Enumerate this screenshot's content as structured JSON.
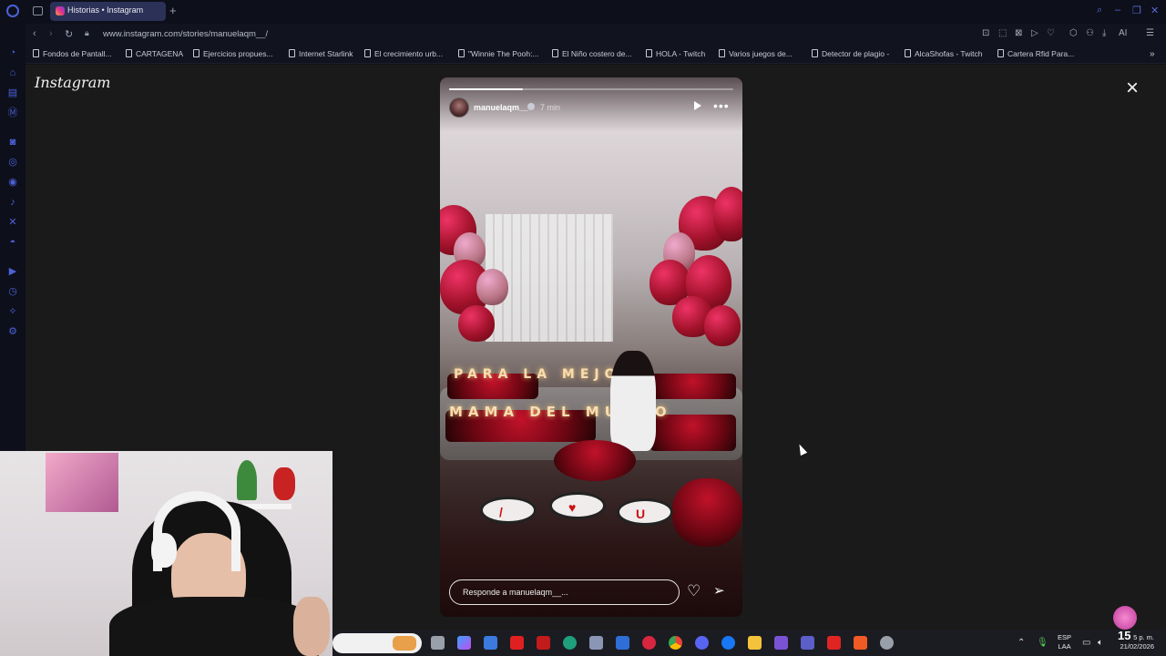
{
  "browser": {
    "tab_title": "Historias • Instagram",
    "new_tab_icon": "+",
    "url": "www.instagram.com/stories/manuelaqm__/",
    "bookmarks": [
      "Fondos de Pantall...",
      "CARTAGENA",
      "Ejercicios propues...",
      "Internet Starlink",
      "El crecimiento urb...",
      "\"Winnie The Pooh:...",
      "El Niño costero de...",
      "HOLA - Twitch",
      "Varios juegos de...",
      "Detector de plagio -",
      "AlcaShofas - Twitch",
      "Cartera Rfid Para..."
    ],
    "ai_label": "AI"
  },
  "instagram": {
    "logo": "Instagram",
    "close_icon": "×"
  },
  "story": {
    "username": "manuelaqm__",
    "time": "7 min",
    "progress": 0.26,
    "more_icon": "•••",
    "scene_letters_top": "PARA LA MEJOR",
    "scene_letters_bottom": "MAMA DEL MUNDO",
    "reply_placeholder": "Responde a manuelaqm__...",
    "heart_icon": "♡",
    "send_icon": "➢"
  },
  "taskbar": {
    "lang_top": "ESP",
    "lang_bottom": "LAA",
    "time": "5 p. m.",
    "date": "21/02/2026",
    "notification_count": "15"
  },
  "colors": {
    "opera_blue": "#4c62d8",
    "tab_active": "#2b3157",
    "page_bg": "#1a1a1a"
  }
}
